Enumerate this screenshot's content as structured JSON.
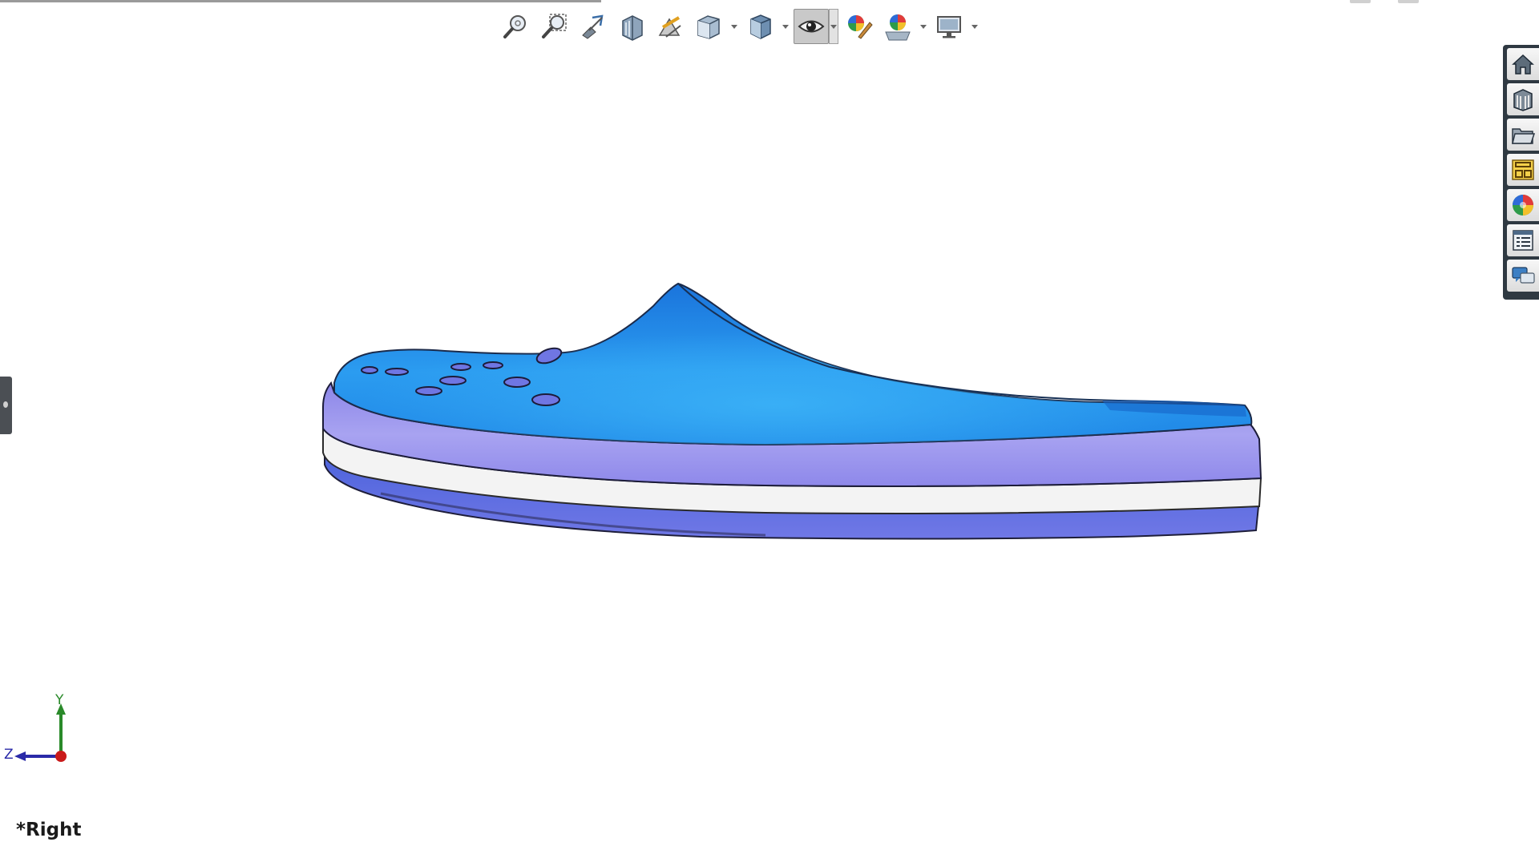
{
  "toolbar": {
    "buttons": [
      {
        "name": "zoom-to-fit-icon"
      },
      {
        "name": "zoom-to-area-icon"
      },
      {
        "name": "previous-view-icon"
      },
      {
        "name": "section-view-icon"
      },
      {
        "name": "dynamic-annotation-views-icon"
      },
      {
        "name": "view-orientation-icon",
        "dropdown": true
      },
      {
        "name": "display-style-icon",
        "dropdown": true
      },
      {
        "name": "hide-show-items-icon",
        "dropdown": true,
        "active": true
      },
      {
        "name": "edit-appearance-icon"
      },
      {
        "name": "apply-scene-icon",
        "dropdown": true
      },
      {
        "name": "view-settings-icon",
        "dropdown": true
      }
    ]
  },
  "task_pane": {
    "tabs": [
      {
        "name": "solidworks-resources-icon"
      },
      {
        "name": "design-library-icon"
      },
      {
        "name": "file-explorer-icon"
      },
      {
        "name": "view-palette-icon"
      },
      {
        "name": "appearances-scenes-decals-icon"
      },
      {
        "name": "custom-properties-icon"
      },
      {
        "name": "forum-icon"
      }
    ]
  },
  "colors": {
    "upper": "#1e8ae8",
    "upper_light": "#34a8f5",
    "midsole": "#9a96ee",
    "stripe": "#f4f4f4",
    "outsole": "#6a72e4"
  },
  "triad": {
    "y_label": "Y",
    "z_label": "Z"
  },
  "view_name": "*Right"
}
